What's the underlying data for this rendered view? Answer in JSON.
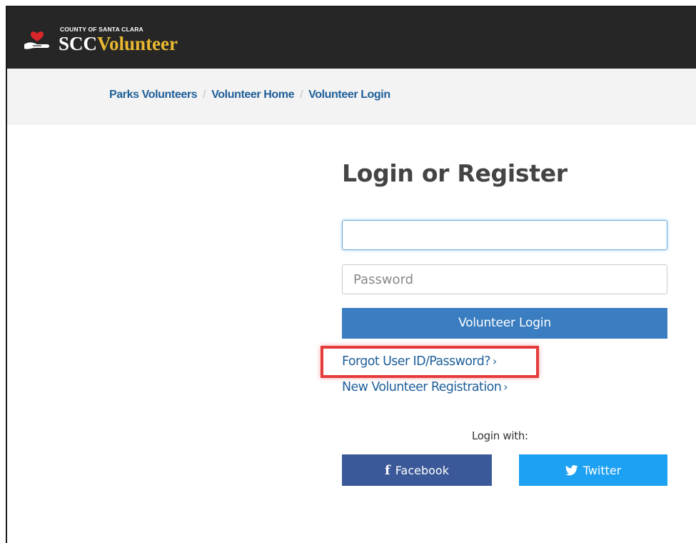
{
  "header": {
    "county_label": "COUNTY OF SANTA CLARA",
    "brand_prefix": "SCC",
    "brand_suffix": "Volunteer"
  },
  "breadcrumb": {
    "items": [
      "Parks Volunteers",
      "Volunteer Home",
      "Volunteer Login"
    ],
    "separator": "/"
  },
  "main": {
    "title": "Login or Register",
    "username": {
      "value": "",
      "placeholder": ""
    },
    "password": {
      "value": "",
      "placeholder": "Password"
    },
    "login_button": "Volunteer Login",
    "forgot_link": "Forgot User ID/Password?",
    "register_link": "New Volunteer Registration",
    "link_chevron": "›",
    "login_with": "Login with:",
    "facebook_label": "Facebook",
    "twitter_label": "Twitter",
    "facebook_icon_glyph": "f"
  },
  "icons": [
    "heart-hand-logo-icon",
    "chevron-right-icon",
    "facebook-icon",
    "twitter-icon"
  ],
  "colors": {
    "topbar": "#262626",
    "brand_accent": "#e8b830",
    "logo_heart": "#d9262a",
    "link": "#1f5f99",
    "primary_button": "#3a7dc0",
    "facebook": "#3b5998",
    "twitter": "#1da1f2",
    "highlight": "#e53b3b"
  }
}
